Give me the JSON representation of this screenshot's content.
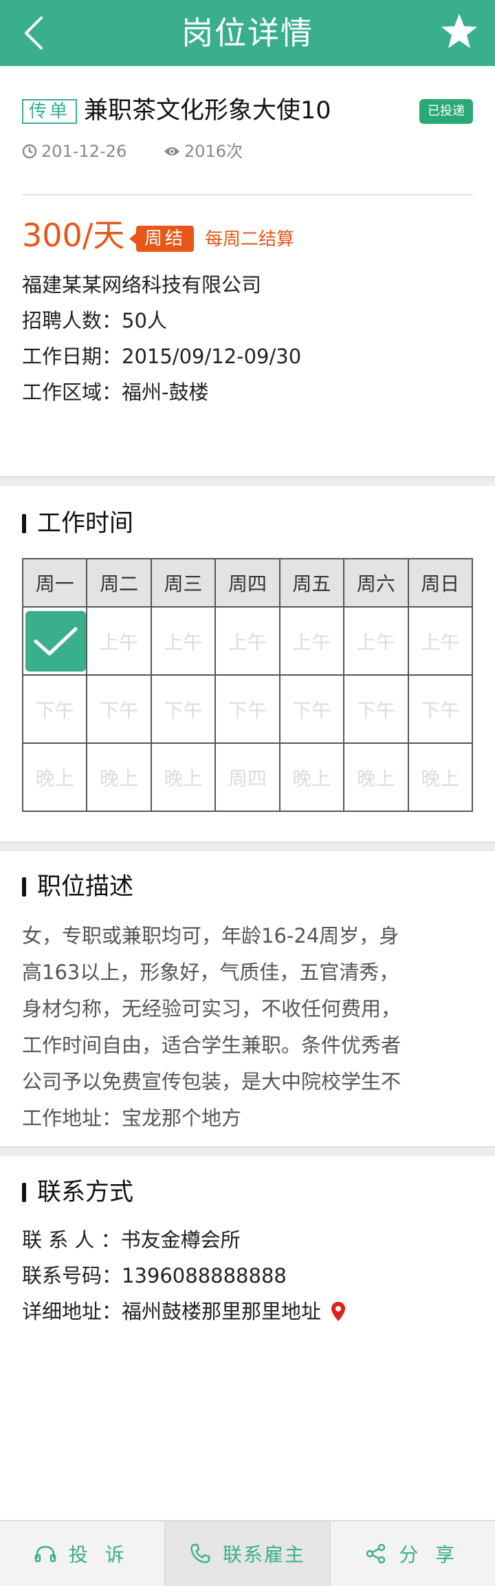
{
  "header": {
    "title": "岗位详情",
    "back_icon": "chevron-left-icon",
    "favorite_icon": "star-icon"
  },
  "job": {
    "tag": "传单",
    "title": "兼职茶文化形象大使10",
    "status_badge": "已投递",
    "date": "201-12-26",
    "views": "2016次",
    "salary": "300/天",
    "pay_cycle": "周结",
    "pay_note": "每周二结算",
    "company": "福建某某网络科技有限公司",
    "headcount": "招聘人数：50人",
    "work_dates": "工作日期：2015/09/12-09/30",
    "work_area": "工作区域：福州-鼓楼"
  },
  "schedule": {
    "title": "工作时间",
    "days": [
      "周一",
      "周二",
      "周三",
      "周四",
      "周五",
      "周六",
      "周日"
    ],
    "rows": [
      [
        "✓",
        "上午",
        "上午",
        "上午",
        "上午",
        "上午",
        "上午"
      ],
      [
        "下午",
        "下午",
        "下午",
        "下午",
        "下午",
        "下午",
        "下午"
      ],
      [
        "晚上",
        "晚上",
        "晚上",
        "周四",
        "晚上",
        "晚上",
        "晚上"
      ]
    ]
  },
  "description": {
    "title": "职位描述",
    "lines": [
      "女，专职或兼职均可，年龄16-24周岁，身",
      "高163以上，形象好，气质佳，五官清秀，",
      "身材匀称，无经验可实习，不收任何费用，",
      "工作时间自由，适合学生兼职。条件优秀者",
      "公司予以免费宣传包装，是大中院校学生不",
      "工作地址：宝龙那个地方"
    ]
  },
  "contact": {
    "title": "联系方式",
    "person": "联 系 人 ：书友金樽会所",
    "phone": "联系号码：1396088888888",
    "address": "详细地址：福州鼓楼那里那里地址"
  },
  "bottom_bar": {
    "complain": "投 诉",
    "contact_employer": "联系雇主",
    "share": "分 享"
  },
  "colors": {
    "brand": "#3aaf8d",
    "accent": "#e8561a",
    "pin": "#e02020"
  }
}
